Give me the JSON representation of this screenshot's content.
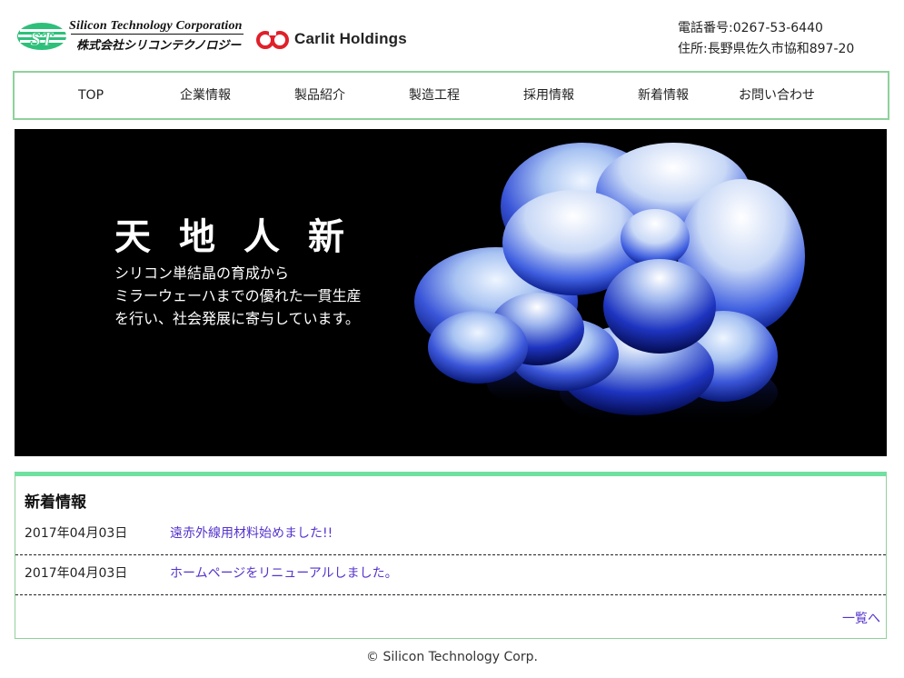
{
  "header": {
    "company_en": "Silicon Technology Corporation",
    "company_jp": "株式会社シリコンテクノロジー",
    "partner_logo": "Carlit Holdings",
    "phone": "電話番号:0267-53-6440",
    "address": "住所:長野県佐久市協和897-20"
  },
  "nav": {
    "items": [
      "TOP",
      "企業情報",
      "製品紹介",
      "製造工程",
      "採用情報",
      "新着情報",
      "お問い合わせ"
    ]
  },
  "hero": {
    "title": "天地人新",
    "lines": [
      "シリコン単結晶の育成から",
      "ミラーウェーハまでの優れた一貫生産",
      "を行い、社会発展に寄与しています。"
    ]
  },
  "news": {
    "heading": "新着情報",
    "items": [
      {
        "date": "2017年04月03日",
        "title": "遠赤外線用材料始めました!!"
      },
      {
        "date": "2017年04月03日",
        "title": "ホームページをリニューアルしました。"
      }
    ],
    "more": "一覧へ"
  },
  "footer": {
    "copyright": "© Silicon Technology Corp."
  },
  "colors": {
    "nav_border": "#8fd19b",
    "news_top_border": "#6fe0a0",
    "link": "#5533cc",
    "stc_green": "#2ec07a",
    "carlit_red": "#e0202a"
  }
}
